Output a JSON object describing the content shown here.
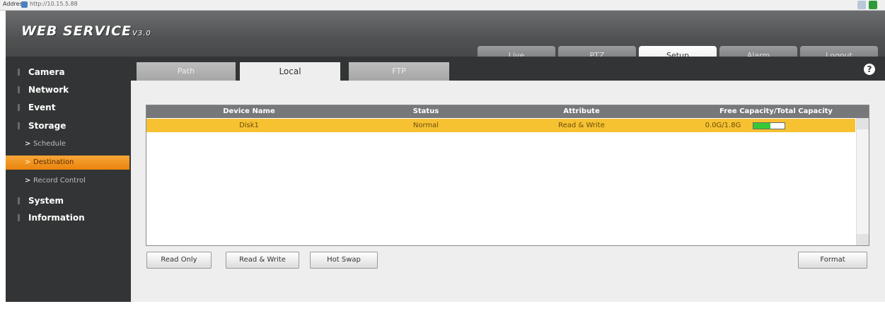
{
  "browser": {
    "tab_label": "Address",
    "url": "http://10.15.5.88"
  },
  "header": {
    "logo": "WEB  SERVICE",
    "version": "V3.0"
  },
  "nav": [
    {
      "label": "Live",
      "active": false
    },
    {
      "label": "PTZ",
      "active": false
    },
    {
      "label": "Setup",
      "active": true
    },
    {
      "label": "Alarm",
      "active": false
    },
    {
      "label": "Logout",
      "active": false
    }
  ],
  "sidebar": {
    "items": [
      {
        "label": "Camera"
      },
      {
        "label": "Network"
      },
      {
        "label": "Event"
      },
      {
        "label": "Storage"
      },
      {
        "label": "System"
      },
      {
        "label": "Information"
      }
    ],
    "storage_sub": [
      {
        "label": "Schedule",
        "active": false
      },
      {
        "label": "Destination",
        "active": true
      },
      {
        "label": "Record Control",
        "active": false
      }
    ]
  },
  "tabs": [
    {
      "label": "Path",
      "active": false
    },
    {
      "label": "Local",
      "active": true
    },
    {
      "label": "FTP",
      "active": false
    }
  ],
  "help_icon": "?",
  "table": {
    "columns": [
      "Device Name",
      "Status",
      "Attribute",
      "Free Capacity/Total Capacity"
    ],
    "rows": [
      {
        "device_name": "Disk1",
        "status": "Normal",
        "attribute": "Read & Write",
        "capacity": "0.0G/1.8G",
        "capacity_fill": 0.55
      }
    ]
  },
  "buttons": {
    "read_only": "Read Only",
    "read_write": "Read & Write",
    "hot_swap": "Hot Swap",
    "format": "Format"
  },
  "colors": {
    "header_bg": "#505253",
    "sidebar_bg": "#333435",
    "active_menu": "#f39a21",
    "selected_row": "#f7c232",
    "capacity_bar": "#36c936"
  }
}
